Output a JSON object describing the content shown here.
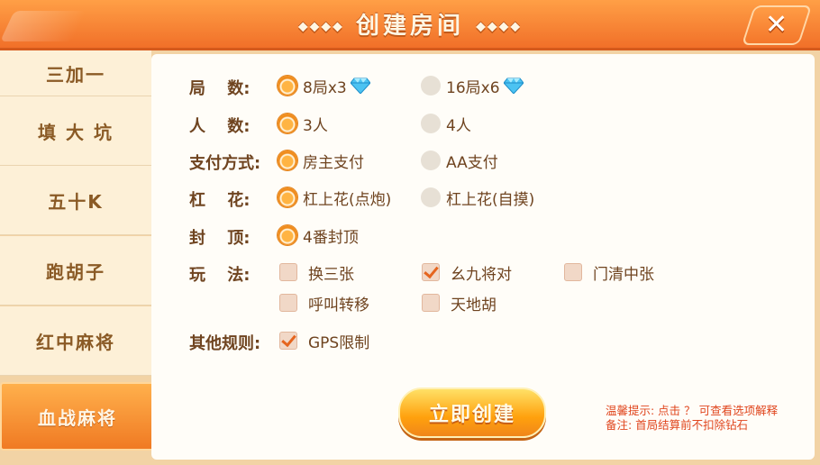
{
  "header": {
    "title": "创建房间",
    "title_deco_left": "◆◆◆◆",
    "title_deco_right": "◆◆◆◆",
    "close_symbol": "✕"
  },
  "sidebar": {
    "items": [
      {
        "label": "三加一",
        "active": false
      },
      {
        "label": "填 大 坑",
        "active": false
      },
      {
        "label": "五十K",
        "active": false
      },
      {
        "label": "跑胡子",
        "active": false
      },
      {
        "label": "红中麻将",
        "active": false
      },
      {
        "label": "血战麻将",
        "active": true
      }
    ]
  },
  "form": {
    "rounds": {
      "label": "局　 数:",
      "options": [
        {
          "text": "8局x3",
          "selected": true,
          "icon": "diamond-icon"
        },
        {
          "text": "16局x6",
          "selected": false,
          "icon": "diamond-icon"
        }
      ]
    },
    "players": {
      "label": "人　 数:",
      "options": [
        {
          "text": "3人",
          "selected": true
        },
        {
          "text": "4人",
          "selected": false
        }
      ]
    },
    "payment": {
      "label": "支付方式:",
      "options": [
        {
          "text": "房主支付",
          "selected": true
        },
        {
          "text": "AA支付",
          "selected": false
        }
      ]
    },
    "gang_hua": {
      "label": "杠　 花:",
      "options": [
        {
          "text": "杠上花(点炮)",
          "selected": true
        },
        {
          "text": "杠上花(自摸)",
          "selected": false
        }
      ]
    },
    "cap": {
      "label": "封　 顶:",
      "options": [
        {
          "text": "4番封顶",
          "selected": true
        }
      ]
    },
    "play": {
      "label": "玩　 法:",
      "options": [
        {
          "text": "换三张",
          "checked": false
        },
        {
          "text": "幺九将对",
          "checked": true
        },
        {
          "text": "门清中张",
          "checked": false
        },
        {
          "text": "呼叫转移",
          "checked": false
        },
        {
          "text": "天地胡",
          "checked": false
        }
      ]
    },
    "other": {
      "label": "其他规则:",
      "options": [
        {
          "text": "GPS限制",
          "checked": true
        }
      ]
    }
  },
  "create_button": {
    "label": "立即创建"
  },
  "hint": {
    "line1": "温馨提示: 点击 ？ 可查看选项解释",
    "line2": "备注: 首局结算前不扣除钻石"
  },
  "colors": {
    "accent": "#f07a23",
    "text": "#6f4420",
    "hint": "#e0461e"
  }
}
